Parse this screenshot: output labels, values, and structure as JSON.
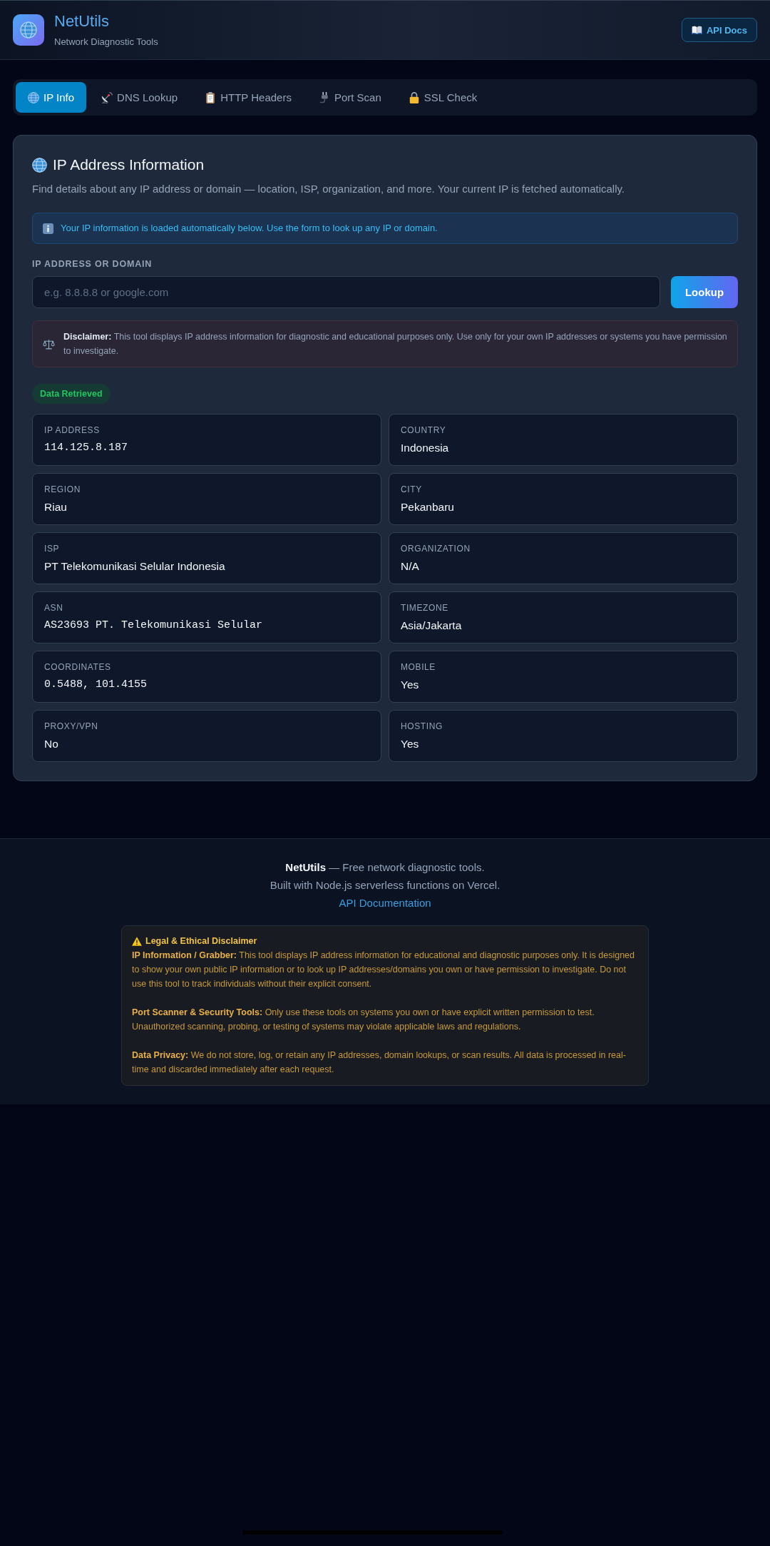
{
  "header": {
    "title": "NetUtils",
    "subtitle": "Network Diagnostic Tools",
    "docs_button": "API Docs"
  },
  "tabs": [
    {
      "label": "IP Info",
      "selected": true
    },
    {
      "label": "DNS Lookup",
      "selected": false
    },
    {
      "label": "HTTP Headers",
      "selected": false
    },
    {
      "label": "Port Scan",
      "selected": false
    },
    {
      "label": "SSL Check",
      "selected": false
    }
  ],
  "panel": {
    "title": "IP Address Information",
    "description": "Find details about any IP address or domain — location, ISP, organization, and more. Your current IP is fetched automatically.",
    "info_notice": "Your IP information is loaded automatically below. Use the form to look up any IP or domain.",
    "field": {
      "label": "IP ADDRESS OR DOMAIN",
      "placeholder": "e.g. 8.8.8.8 or google.com"
    },
    "lookup_button": "Lookup",
    "disclaimer": "**Disclaimer:** This tool displays IP address information for diagnostic and educational purposes only. Use only for your own IP addresses or systems you have permission to investigate.",
    "status_badge": "Data Retrieved",
    "results": [
      {
        "label": "IP ADDRESS",
        "value": "114.125.8.187",
        "kind": "mono"
      },
      {
        "label": "COUNTRY",
        "value": "Indonesia",
        "kind": "text"
      },
      {
        "label": "REGION",
        "value": "Riau",
        "kind": "text"
      },
      {
        "label": "CITY",
        "value": "Pekanbaru",
        "kind": "text"
      },
      {
        "label": "ISP",
        "value": "PT Telekomunikasi Selular Indonesia",
        "kind": "text"
      },
      {
        "label": "ORGANIZATION",
        "value": "N/A",
        "kind": "text"
      },
      {
        "label": "ASN",
        "value": "AS23693 PT. Telekomunikasi Selular",
        "kind": "mono"
      },
      {
        "label": "TIMEZONE",
        "value": "Asia/Jakarta",
        "kind": "text"
      },
      {
        "label": "COORDINATES",
        "value": "0.5488, 101.4155",
        "kind": "mono"
      },
      {
        "label": "MOBILE",
        "value": "Yes",
        "kind": "text"
      },
      {
        "label": "PROXY/VPN",
        "value": "No",
        "kind": "text"
      },
      {
        "label": "HOSTING",
        "value": "Yes",
        "kind": "text"
      }
    ]
  },
  "footer": {
    "tagline": "**NetUtils** — Free network diagnostic tools.",
    "built_with": "Built with Node.js serverless functions on Vercel.",
    "docs_link": "API Documentation",
    "legal": {
      "title": "Legal & Ethical Disclaimer",
      "paragraphs": [
        "**IP Information / Grabber:** This tool displays IP address information for educational and diagnostic purposes only. It is designed to show your own public IP information or to look up IP addresses/domains you own or have permission to investigate. Do not use this tool to track individuals without their explicit consent.",
        "**Port Scanner & Security Tools:** Only use these tools on systems you own or have explicit written permission to test. Unauthorized scanning, probing, or testing of systems may violate applicable laws and regulations.",
        "**Data Privacy:** We do not store, log, or retain any IP addresses, domain lookups, or scan results. All data is processed in real-time and discarded immediately after each request."
      ]
    }
  }
}
